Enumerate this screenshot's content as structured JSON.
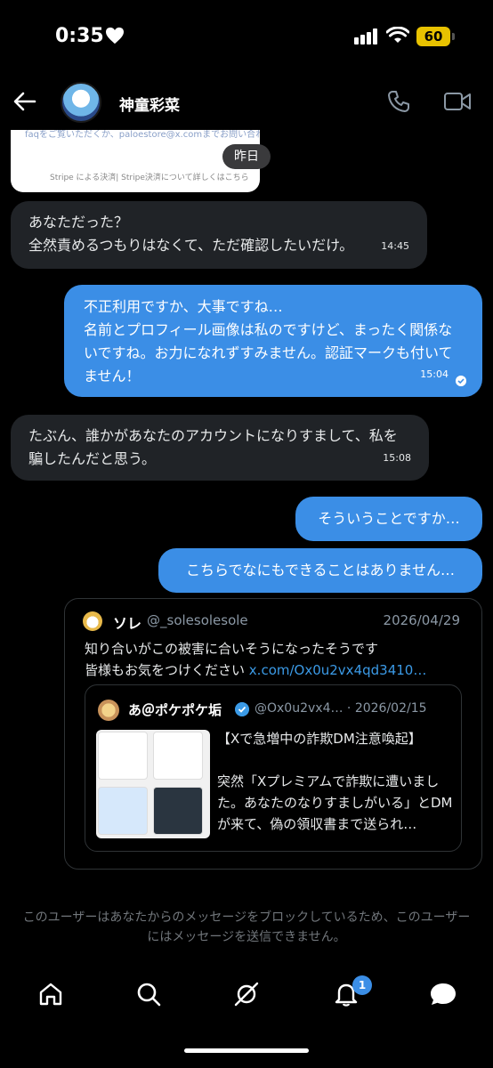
{
  "status_bar": {
    "time": "0:35",
    "battery": "60"
  },
  "header": {
    "contact_name": "神童彩菜"
  },
  "receipt_preview": {
    "line1": "faqをご覧いただくか、paloestore@x.comまでお問い合わせください",
    "line2": "Stripe による決済| Stripe決済について詳しくはこちら"
  },
  "date_chip": "昨日",
  "messages": [
    {
      "text": "あなただった？\n全然責めるつもりはなくて、ただ確認したいだけ。",
      "time": "14:45"
    },
    {
      "text": "不正利用ですか、大事ですね…\n名前とプロフィール画像は私のですけど、まったく関係ないですね。お力になれずすみません。認証マークも付いてません！",
      "time": "15:04"
    },
    {
      "text": "たぶん、誰かがあなたのアカウントになりすまして、私を騙したんだと思う。",
      "time": "15:08"
    },
    {
      "text": "そういうことですか…"
    },
    {
      "text": "こちらでなにもできることはありません…"
    }
  ],
  "quote": {
    "name": "ソレ",
    "handle": "@_solesolesole",
    "date": "2026/04/29",
    "body_line1": "知り合いがこの被害に合いそうになったそうです",
    "body_line2": "皆様もお気をつけください",
    "link": "x.com/Ox0u2vx4qd3410…",
    "inner": {
      "name": "あ＠ポケポケ垢",
      "handle": "@Ox0u2vx4… · 2026/02/15",
      "text": "【Xで急増中の詐欺DM注意喚起】\n\n突然「Xプレミアムで詐欺に遭いました。あなたのなりすましがいる」とDMが来て、偽の領収書まで送られ…"
    }
  },
  "blocked_notice": "このユーザーはあなたからのメッセージをブロックしているため、このユーザーにはメッセージを送信できません。",
  "nav": {
    "notification_count": "1"
  }
}
